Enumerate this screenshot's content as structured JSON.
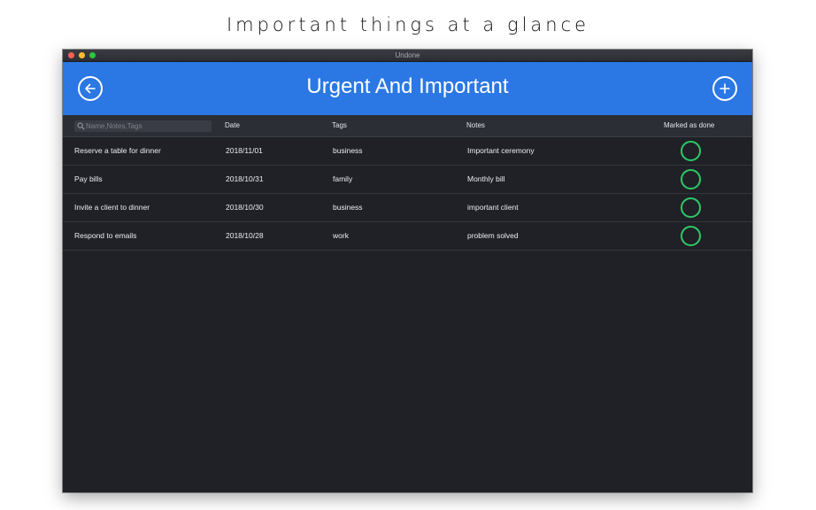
{
  "tagline": "Important things at a glance",
  "window": {
    "title": "Undone"
  },
  "header": {
    "title": "Urgent And Important",
    "back_icon": "arrow-left-icon",
    "add_icon": "plus-icon"
  },
  "search": {
    "placeholder": "Name,Notes,Tags",
    "value": ""
  },
  "columns": {
    "date": "Date",
    "tags": "Tags",
    "notes": "Notes",
    "done": "Marked as done"
  },
  "rows": [
    {
      "name": "Reserve a table for dinner",
      "date": "2018/11/01",
      "tag": "business",
      "note": "Important ceremony",
      "done": false
    },
    {
      "name": "Pay bills",
      "date": "2018/10/31",
      "tag": "family",
      "note": "Monthly bill",
      "done": false
    },
    {
      "name": "Invite a client to dinner",
      "date": "2018/10/30",
      "tag": "business",
      "note": "important client",
      "done": false
    },
    {
      "name": "Respond to emails",
      "date": "2018/10/28",
      "tag": "work",
      "note": "problem solved",
      "done": false
    }
  ],
  "colors": {
    "accent": "#2b78e4",
    "background": "#1f2127",
    "done_ring": "#2ec866"
  }
}
